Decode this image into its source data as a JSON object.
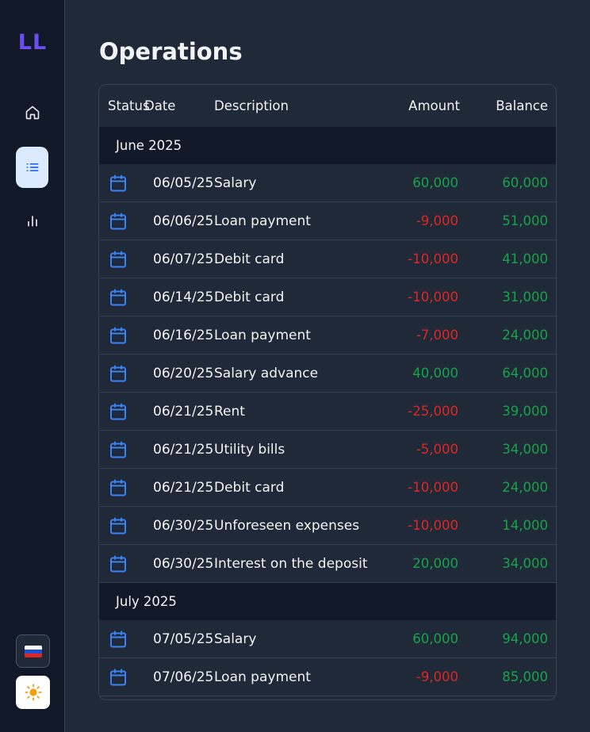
{
  "app": {
    "logo": "LL",
    "page_title": "Operations"
  },
  "sidebar": {
    "items": [
      {
        "icon": "home-icon",
        "label": ""
      },
      {
        "icon": "list-icon",
        "label": "",
        "active": true
      },
      {
        "icon": "bar-chart-icon",
        "label": ""
      }
    ],
    "language_flag": "flag-russia-icon",
    "theme_icon": "sun-icon"
  },
  "table": {
    "headers": {
      "status": "Status",
      "date": "Date",
      "description": "Description",
      "amount": "Amount",
      "balance": "Balance"
    },
    "groups": [
      {
        "month": "June 2025",
        "rows": [
          {
            "date": "06/05/25",
            "description": "Salary",
            "amount": "60,000",
            "balance": "60,000",
            "amount_sign": "pos",
            "balance_sign": "pos"
          },
          {
            "date": "06/06/25",
            "description": "Loan payment",
            "amount": "-9,000",
            "balance": "51,000",
            "amount_sign": "neg",
            "balance_sign": "pos"
          },
          {
            "date": "06/07/25",
            "description": "Debit card",
            "amount": "-10,000",
            "balance": "41,000",
            "amount_sign": "neg",
            "balance_sign": "pos"
          },
          {
            "date": "06/14/25",
            "description": "Debit card",
            "amount": "-10,000",
            "balance": "31,000",
            "amount_sign": "neg",
            "balance_sign": "pos"
          },
          {
            "date": "06/16/25",
            "description": "Loan payment",
            "amount": "-7,000",
            "balance": "24,000",
            "amount_sign": "neg",
            "balance_sign": "pos"
          },
          {
            "date": "06/20/25",
            "description": "Salary advance",
            "amount": "40,000",
            "balance": "64,000",
            "amount_sign": "pos",
            "balance_sign": "pos"
          },
          {
            "date": "06/21/25",
            "description": "Rent",
            "amount": "-25,000",
            "balance": "39,000",
            "amount_sign": "neg",
            "balance_sign": "pos"
          },
          {
            "date": "06/21/25",
            "description": "Utility bills",
            "amount": "-5,000",
            "balance": "34,000",
            "amount_sign": "neg",
            "balance_sign": "pos"
          },
          {
            "date": "06/21/25",
            "description": "Debit card",
            "amount": "-10,000",
            "balance": "24,000",
            "amount_sign": "neg",
            "balance_sign": "pos"
          },
          {
            "date": "06/30/25",
            "description": "Unforeseen expenses",
            "amount": "-10,000",
            "balance": "14,000",
            "amount_sign": "neg",
            "balance_sign": "pos"
          },
          {
            "date": "06/30/25",
            "description": "Interest on the deposit",
            "amount": "20,000",
            "balance": "34,000",
            "amount_sign": "pos",
            "balance_sign": "pos"
          }
        ]
      },
      {
        "month": "July 2025",
        "rows": [
          {
            "date": "07/05/25",
            "description": "Salary",
            "amount": "60,000",
            "balance": "94,000",
            "amount_sign": "pos",
            "balance_sign": "pos"
          },
          {
            "date": "07/06/25",
            "description": "Loan payment",
            "amount": "-9,000",
            "balance": "85,000",
            "amount_sign": "neg",
            "balance_sign": "pos"
          }
        ]
      }
    ]
  },
  "colors": {
    "accent": "#3b82f6",
    "positive": "#16a34a",
    "negative": "#dc2626",
    "logo": "#6d4cf0"
  }
}
